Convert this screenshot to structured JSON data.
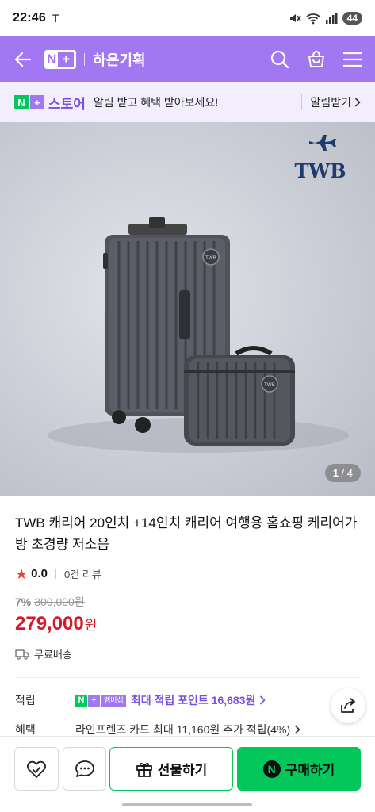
{
  "status_bar": {
    "time": "22:46",
    "carrier": "T",
    "battery": "44"
  },
  "header": {
    "store_title": "하은기획"
  },
  "store_banner": {
    "brand": "스토어",
    "message": "알림 받고 혜택 받아보세요!",
    "link": "알림받기"
  },
  "hero": {
    "logo_text": "TWB",
    "badge_text": "TWB",
    "page_current": "1",
    "page_total": "4"
  },
  "product": {
    "title": "TWB 캐리어 20인치 +14인치 캐리어 여행용 홈쇼핑 케리어가방 초경량 저소음",
    "rating": "0.0",
    "review_count": "0건 리뷰",
    "discount": "7%",
    "original_price": "300,000원",
    "price": "279,000",
    "currency": "원",
    "shipping": "무료배송"
  },
  "points": {
    "label": "적립",
    "membership_tag": "멤버십",
    "text": "최대 적립 포인트 16,683원"
  },
  "benefit": {
    "label": "혜택",
    "text": "라인프렌즈 카드 최대 11,160원 추가 적립(4%)"
  },
  "bottom_bar": {
    "gift_label": "선물하기",
    "buy_label": "구매하기"
  },
  "colors": {
    "accent": "#a277f2",
    "naver_green": "#03c75a",
    "price_red": "#d11b2d"
  }
}
